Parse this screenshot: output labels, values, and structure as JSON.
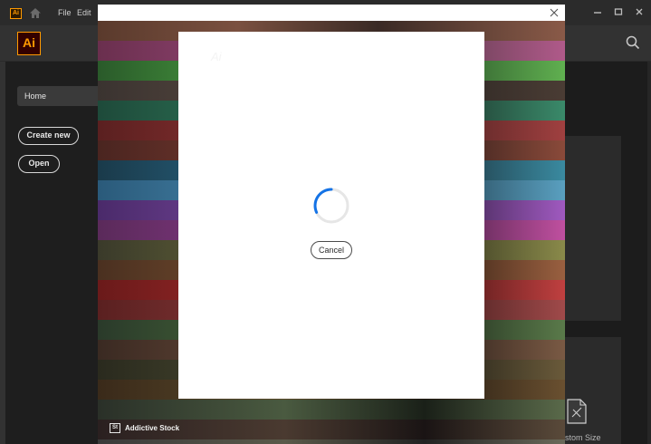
{
  "titlebar": {
    "app_badge": "Ai",
    "menu": [
      {
        "label": "File"
      },
      {
        "label": "Edit"
      }
    ],
    "icons": [
      "home-icon",
      "minimize-icon",
      "maximize-icon",
      "close-icon"
    ]
  },
  "header": {
    "logo": "Ai",
    "icons": [
      "search-icon"
    ]
  },
  "sidebar": {
    "home_label": "Home",
    "create_new_label": "Create new",
    "open_label": "Open"
  },
  "right_panel": {
    "preset_label": "stom Size",
    "icons": [
      "custom-size-icon"
    ]
  },
  "overlay": {
    "stock_badge": "St",
    "stock_label": "Addictive Stock",
    "icons": [
      "close-icon"
    ]
  },
  "modal": {
    "cancel_label": "Cancel",
    "icons": [
      "loading-spinner-icon"
    ]
  },
  "colors": {
    "brand_orange": "#ff9a00",
    "spinner_blue": "#1473e6",
    "chrome_dark": "#2b2b2b",
    "sidebar_bg": "#1e1e1e"
  }
}
